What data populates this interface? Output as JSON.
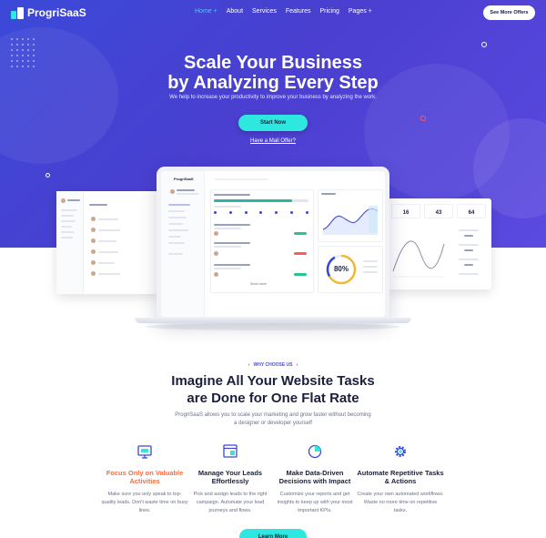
{
  "brand": {
    "name": "ProgriSaaS"
  },
  "nav": {
    "items": [
      "Home +",
      "About",
      "Services",
      "Features",
      "Pricing",
      "Pages +"
    ],
    "cta": "See More Offers"
  },
  "hero": {
    "title_line1": "Scale Your Business",
    "title_line2": "by Analyzing Every Step",
    "subtitle": "We help to increase your productivity to improve your business by analyzing the work.",
    "start_button": "Start Now",
    "mail_link": "Have a Mail Offer?"
  },
  "dashboard": {
    "brand": "ProgriSaaS",
    "progress_value": "80%",
    "stats": [
      "16",
      "43",
      "64"
    ],
    "more_button": "Show more"
  },
  "why": {
    "eyebrow": "WHY CHOOSE US",
    "title_line1": "Imagine All Your Website Tasks",
    "title_line2": "are Done for One Flat Rate",
    "text": "ProgriSaaS allows you to scale your marketing and grow faster without becoming a designer or developer yourself"
  },
  "features": [
    {
      "icon": "monitor-icon",
      "title": "Focus Only on Valuable Activities",
      "desc": "Make sure you only speak to top-quality leads. Don't waste time on busy lines."
    },
    {
      "icon": "browser-icon",
      "title": "Manage Your Leads Effortlessly",
      "desc": "Pick and assign leads to the right campaign. Automate your lead journeys and flows."
    },
    {
      "icon": "pie-chart-icon",
      "title": "Make Data-Driven Decisions with Impact",
      "desc": "Customize your reports and get insights to keep up with your most important KPIs."
    },
    {
      "icon": "gear-icon",
      "title": "Automate Repetitive Tasks & Actions",
      "desc": "Create your own automated workflows. Waste no more time on repetitive tasks."
    }
  ],
  "learn_button": "Learn More",
  "colors": {
    "accent": "#2ee8e0",
    "hero": "#4140d2",
    "highlight": "#ff6b3d",
    "chart_line": "#4b55e0",
    "ring": "#f5b731"
  }
}
